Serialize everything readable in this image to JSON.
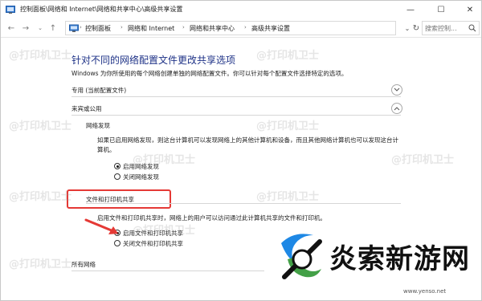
{
  "window": {
    "title": "控制面板\\网络和 Internet\\网络和共享中心\\高级共享设置",
    "minimize": "—",
    "maximize": "☐",
    "close": "✕"
  },
  "address_bar": {
    "back": "←",
    "forward": "→",
    "up": "↑",
    "breadcrumbs": [
      "控制面板",
      "网络和 Internet",
      "网络和共享中心",
      "高级共享设置"
    ],
    "separator": "›",
    "dropdown": "⌄",
    "refresh": "↻",
    "search_placeholder": "搜索控制..."
  },
  "main": {
    "title": "针对不同的网络配置文件更改共享选项",
    "description": "Windows 为你所使用的每个网络创建单独的网络配置文件。你可以针对每个配置文件选择特定的选项。",
    "sections": [
      {
        "label": "专用 (当前配置文件)",
        "expanded": false
      },
      {
        "label": "来宾或公用",
        "expanded": true
      },
      {
        "label": "所有网络",
        "expanded": false
      }
    ],
    "network_discovery": {
      "label": "网络发现",
      "text": "如果已启用网络发现，则这台计算机可以发现网络上的其他计算机和设备，而且其他网络计算机也可以发现这台计算机。",
      "options": [
        {
          "label": "启用网络发现",
          "checked": true
        },
        {
          "label": "关闭网络发现",
          "checked": false
        }
      ]
    },
    "file_printer_sharing": {
      "label": "文件和打印机共享",
      "text": "启用文件和打印机共享时，网络上的用户可以访问通过此计算机共享的文件和打印机。",
      "options": [
        {
          "label": "启用文件和打印机共享",
          "checked": true
        },
        {
          "label": "关闭文件和打印机共享",
          "checked": false
        }
      ]
    }
  },
  "watermarks": [
    "@打印机卫士",
    "@打印机卫士",
    "@打印机卫士",
    "@打印机卫士",
    "@打印机卫士",
    "@打印机卫士",
    "@打印机卫士",
    "@打印机卫士",
    "@打印机卫士",
    "@打印机卫士"
  ],
  "logo": {
    "text": "炎索新游网",
    "url": "www.yenso.net"
  },
  "colors": {
    "title_blue": "#1e3287",
    "highlight_red": "#e53935"
  }
}
